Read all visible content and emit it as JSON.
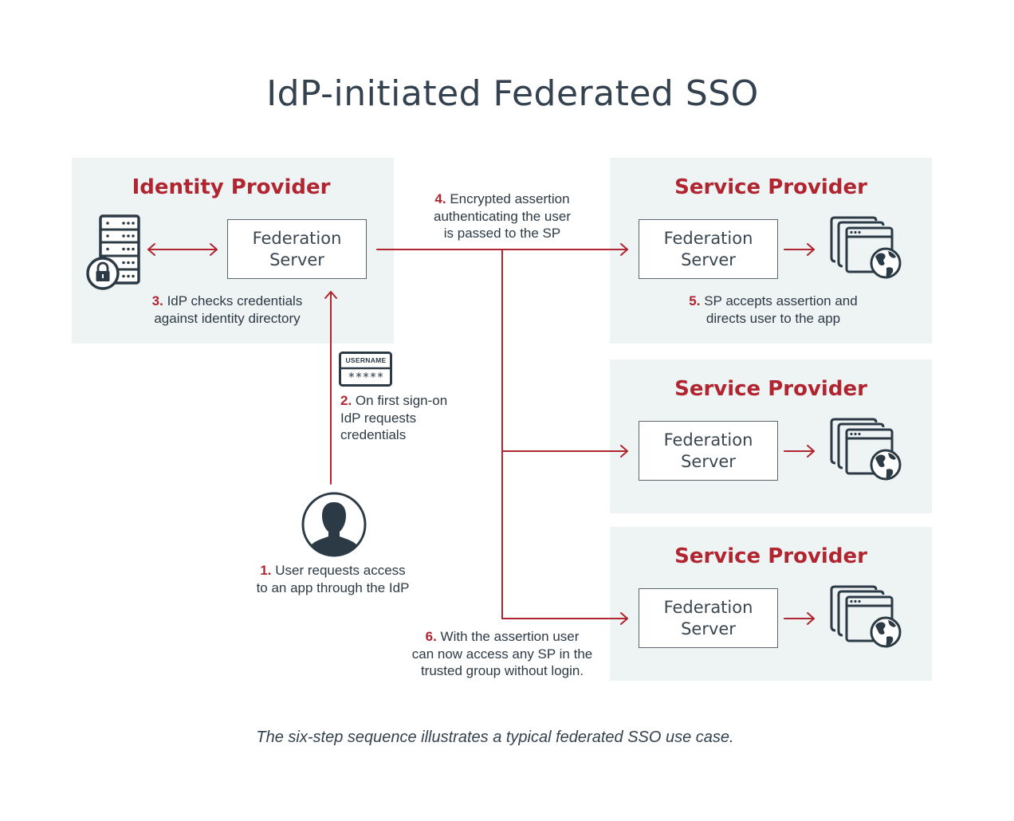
{
  "title": "IdP-initiated Federated SSO",
  "colors": {
    "accent": "#b0252f",
    "text": "#2d3a45",
    "panel_bg": "#eef3f4",
    "icon": "#2b3a45"
  },
  "identity_provider": {
    "title": "Identity Provider",
    "server_label_line1": "Federation",
    "server_label_line2": "Server",
    "icons": [
      "server-rack-icon",
      "lock-icon"
    ]
  },
  "service_providers": [
    {
      "title": "Service Provider",
      "server_label_line1": "Federation",
      "server_label_line2": "Server",
      "icon": "browser-windows-globe-icon"
    },
    {
      "title": "Service Provider",
      "server_label_line1": "Federation",
      "server_label_line2": "Server",
      "icon": "browser-windows-globe-icon"
    },
    {
      "title": "Service Provider",
      "server_label_line1": "Federation",
      "server_label_line2": "Server",
      "icon": "browser-windows-globe-icon"
    }
  ],
  "credentials_card": {
    "username_label": "USERNAME",
    "password_mask": "*****"
  },
  "steps": [
    {
      "num": "1.",
      "lines": [
        "User requests access",
        "to an app through the IdP"
      ]
    },
    {
      "num": "2.",
      "lines": [
        "On first sign-on",
        "IdP requests",
        "credentials"
      ]
    },
    {
      "num": "3.",
      "lines": [
        "IdP checks credentials",
        "against identity directory"
      ]
    },
    {
      "num": "4.",
      "lines": [
        "Encrypted assertion",
        "authenticating the user",
        "is passed to the SP"
      ]
    },
    {
      "num": "5.",
      "lines": [
        "SP accepts assertion and",
        "directs user to the app"
      ]
    },
    {
      "num": "6.",
      "lines": [
        "With the assertion user",
        "can now access any SP in the",
        "trusted group without login."
      ]
    }
  ],
  "caption": "The six-step sequence illustrates a typical federated SSO use case."
}
